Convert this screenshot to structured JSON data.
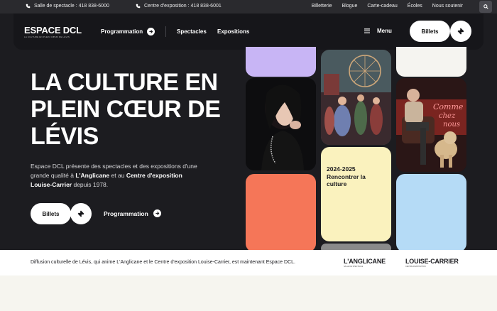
{
  "topbar": {
    "phone_salle": "Salle de spectacle : 418 838-6000",
    "phone_centre": "Centre d'exposition : 418 838-6001",
    "links": [
      "Billetterie",
      "Blogue",
      "Carte-cadeau",
      "Écoles",
      "Nous soutenir"
    ]
  },
  "nav": {
    "logo": "ESPACE DCL",
    "logo_sub": "LA CULTURE EN PLEIN CŒUR DE LÉVIS",
    "programmation": "Programmation",
    "spectacles": "Spectacles",
    "expositions": "Expositions",
    "menu": "Menu",
    "billets": "Billets"
  },
  "hero": {
    "title": "La culture en plein cœur de Lévis",
    "desc_1": "Espace DCL présente des spectacles et des expositions d'une grande qualité à ",
    "desc_b1": "L'Anglicane",
    "desc_2": " et au ",
    "desc_b2": "Centre d'exposition Louise-Carrier",
    "desc_3": " depuis 1978.",
    "billets": "Billets",
    "programmation": "Programmation"
  },
  "tiles": {
    "season": "2024-2025 Rencontrer la culture"
  },
  "band": {
    "text": "Diffusion culturelle de Lévis, qui anime L'Anglicane et le Centre d'exposition Louise-Carrier, est maintenant Espace DCL.",
    "logo1": "L'ANGLICANE",
    "logo1_sub": "SALLE DE SPECTACLE",
    "logo2": "LOUISE-CARRIER",
    "logo2_sub": "CENTRE D'EXPOSITION"
  },
  "colors": {
    "dark": "#1c1c20",
    "lavender": "#c8b5f5",
    "yellow": "#faf2be",
    "orange": "#f57658",
    "blue": "#b5dbf6"
  }
}
